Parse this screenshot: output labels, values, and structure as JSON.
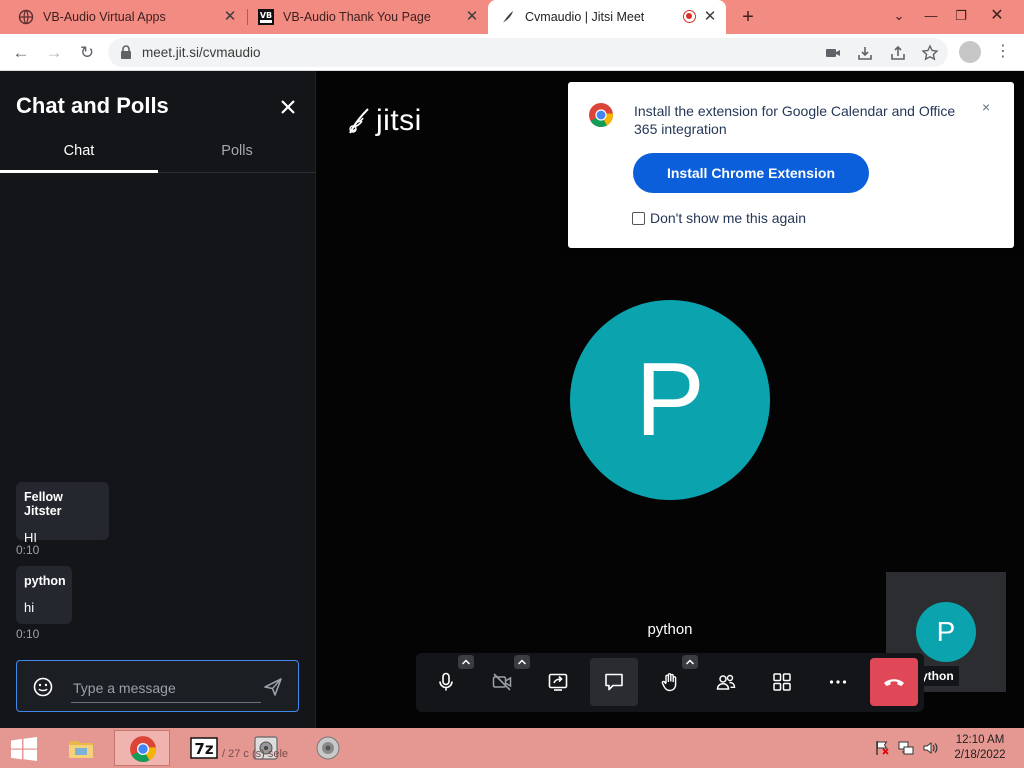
{
  "browser": {
    "tabs": [
      {
        "title": "VB-Audio Virtual Apps",
        "active": false
      },
      {
        "title": "VB-Audio Thank You Page",
        "active": false
      },
      {
        "title": "Cvmaudio | Jitsi Meet",
        "active": true
      }
    ],
    "new_tab_label": "+",
    "url": "meet.jit.si/cvmaudio"
  },
  "chat": {
    "title": "Chat and Polls",
    "tabs": [
      "Chat",
      "Polls"
    ],
    "messages": [
      {
        "sender": "Fellow Jitster",
        "text": "HI",
        "time": "0:10"
      },
      {
        "sender": "python",
        "text": "hi",
        "time": "0:10"
      }
    ],
    "input_placeholder": "Type a message"
  },
  "stage": {
    "logo_text": "jitsi",
    "speaker_initial": "P",
    "speaker_name": "python",
    "thumbnail_initial": "P",
    "thumbnail_name": "ython"
  },
  "notification": {
    "text": "Install the extension for Google Calendar and Office 365 integration",
    "button": "Install Chrome Extension",
    "checkbox_label": "Don't show me this again",
    "close": "×"
  },
  "taskbar": {
    "ghost_text": "/ 27 c      (s) sele",
    "time": "12:10 AM",
    "date": "2/18/2022"
  },
  "colors": {
    "tab_strip": "#f28b82",
    "avatar": "#0ba3ad",
    "install_button": "#0b5fdb",
    "hangup": "#e04757",
    "composer_border": "#4687ed",
    "taskbar": "#e59892"
  }
}
